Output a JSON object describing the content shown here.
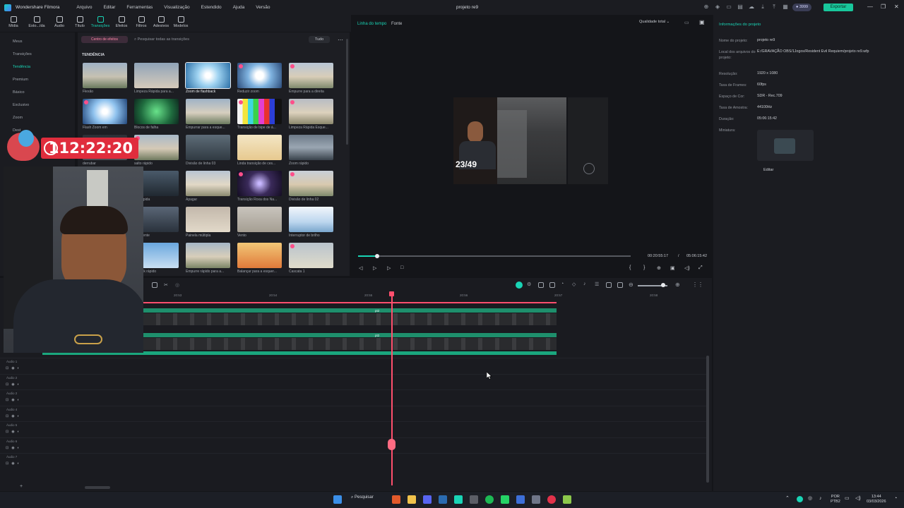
{
  "titlebar": {
    "app_name": "Wondershare Filmora",
    "menu": [
      "Arquivo",
      "Editar",
      "Ferramentas",
      "Visualização",
      "Estendido",
      "Ajuda",
      "Versão"
    ],
    "project_title": "projeto re9",
    "credits": "3999",
    "export_label": "Exportar"
  },
  "toolbar": {
    "items": [
      {
        "label": "Mídia",
        "icon": "media-icon"
      },
      {
        "label": "Esto...ída",
        "icon": "stock-icon"
      },
      {
        "label": "Áudio",
        "icon": "audio-icon"
      },
      {
        "label": "Título",
        "icon": "title-icon"
      },
      {
        "label": "Transições",
        "icon": "transitions-icon"
      },
      {
        "label": "Efeitos",
        "icon": "effects-icon"
      },
      {
        "label": "Filtros",
        "icon": "filters-icon"
      },
      {
        "label": "Adesivos",
        "icon": "stickers-icon"
      },
      {
        "label": "Modelos",
        "icon": "templates-icon"
      }
    ],
    "active_index": 4
  },
  "leftnav": {
    "items": [
      "Meus",
      "Transições",
      "Tendência",
      "Premium",
      "Básico",
      "Exclusivo",
      "Zoom",
      "Dest"
    ],
    "active_index": 2
  },
  "assets": {
    "effects_center_label": "Centro de efeitos",
    "search_placeholder": "Pesquisar todas as transições",
    "filter_label": "Tudo",
    "section_title": "TENDÊNCIA",
    "tiles": [
      {
        "label": "Flexão"
      },
      {
        "label": "Limpeza Rápida para a..."
      },
      {
        "label": "Zoom de flashback"
      },
      {
        "label": "Reduzir zoom"
      },
      {
        "label": "Empurre para a direita"
      },
      {
        "label": "Flash Zoom em"
      },
      {
        "label": "Blocos de falha"
      },
      {
        "label": "Empurrar para a esque..."
      },
      {
        "label": "Transição de bipe de á..."
      },
      {
        "label": "Limpeza Rápida Esque..."
      },
      {
        "label": "derrubar"
      },
      {
        "label": "salto rápido"
      },
      {
        "label": "Divisão de linha 03"
      },
      {
        "label": "Linda transição de ces..."
      },
      {
        "label": "Zoom rápido"
      },
      {
        "label": "...o rápida"
      },
      {
        "label": "Apagar"
      },
      {
        "label": "Transição Roxa dos Na..."
      },
      {
        "label": "Divisão de linha 02"
      },
      {
        "label": "...da lente"
      },
      {
        "label": "Painela múltipla"
      },
      {
        "label": "Vento"
      },
      {
        "label": "Interruptor de brilho"
      },
      {
        "label": "...black rápido"
      },
      {
        "label": "Empurre rápido para a..."
      },
      {
        "label": "Balançar para a esquer..."
      },
      {
        "label": "Cascata 1"
      }
    ]
  },
  "preview": {
    "tab_timeline": "Linha do tempo",
    "tab_source": "Fonte",
    "quality": "Qualidade total",
    "overlay_counter": "23/49",
    "current_time": "00:20:55:17",
    "separator": "/",
    "total_time": "05:06:15:42",
    "progress_fraction": 0.07
  },
  "info": {
    "title": "Informações do projeto",
    "rows": [
      {
        "key": "Nome do projeto:",
        "value": "projeto re9"
      },
      {
        "key": "Local dos arquivos do projeto:",
        "value": "E:/GRAVAÇÃO OBS/1Jogos/Resident Evil Requiem/projeto re9.wfp"
      },
      {
        "key": "Resolução:",
        "value": "1920 x 1080"
      },
      {
        "key": "Taxa de Frames:",
        "value": "60fps"
      },
      {
        "key": "Espaço de Cor:",
        "value": "SDR - Rec.709"
      },
      {
        "key": "Taxa de Amostra:",
        "value": "44100Hz"
      },
      {
        "key": "Duração:",
        "value": "05:06:15:42"
      },
      {
        "key": "Miniatura:",
        "value": ""
      }
    ],
    "edit_label": "Editar"
  },
  "timeline": {
    "ruler": [
      "20:53",
      "20:54",
      "20:55",
      "20:56",
      "20:57",
      "20:58"
    ],
    "tracks": [
      "Áudio 1",
      "Áudio 2",
      "Áudio 2",
      "Áudio 4",
      "Áudio 5",
      "Áudio 6",
      "Áudio 7"
    ],
    "clip_tag": "pt2"
  },
  "overlay": {
    "timer": "112:22:20"
  },
  "taskbar": {
    "search_label": "Pesquisar",
    "lang_top": "POR",
    "lang_bottom": "PTB2",
    "time": "13:44",
    "date": "03/03/2026"
  }
}
